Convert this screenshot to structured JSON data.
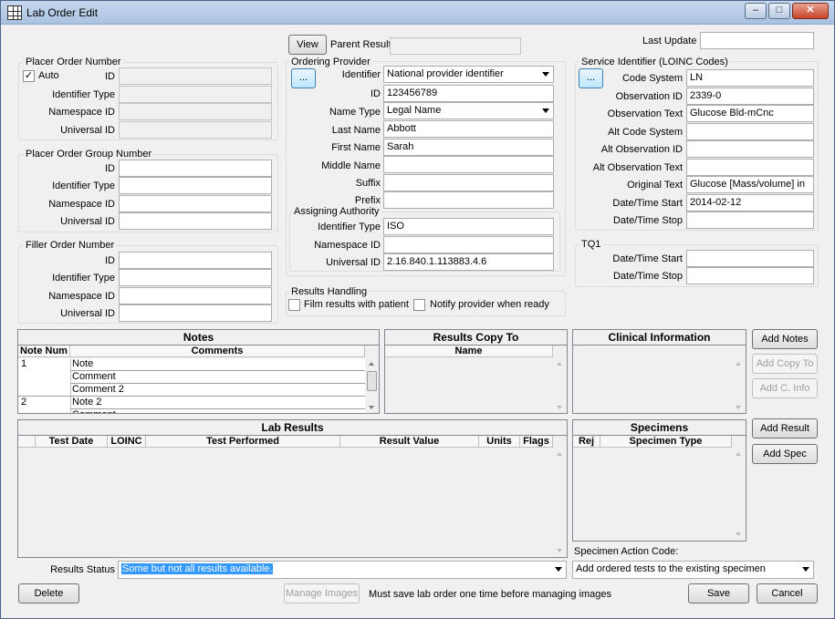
{
  "window": {
    "title": "Lab Order Edit",
    "minimize": "–",
    "maximize": "□",
    "close": "✕"
  },
  "top": {
    "view_label": "View",
    "parent_result_label": "Parent Result",
    "parent_result_value": "",
    "last_update_label": "Last Update",
    "last_update_value": ""
  },
  "placer_order": {
    "title": "Placer Order Number",
    "auto_label": "Auto",
    "auto_checked": "✓",
    "labels": {
      "id": "ID",
      "identifier_type": "Identifier Type",
      "namespace_id": "Namespace ID",
      "universal_id": "Universal ID"
    },
    "values": {
      "id": "",
      "identifier_type": "",
      "namespace_id": "",
      "universal_id": ""
    }
  },
  "placer_group": {
    "title": "Placer Order Group Number",
    "labels": {
      "id": "ID",
      "identifier_type": "Identifier Type",
      "namespace_id": "Namespace ID",
      "universal_id": "Universal ID"
    },
    "values": {
      "id": "",
      "identifier_type": "",
      "namespace_id": "",
      "universal_id": ""
    }
  },
  "filler_order": {
    "title": "Filler Order Number",
    "labels": {
      "id": "ID",
      "identifier_type": "Identifier Type",
      "namespace_id": "Namespace ID",
      "universal_id": "Universal ID"
    },
    "values": {
      "id": "",
      "identifier_type": "",
      "namespace_id": "",
      "universal_id": ""
    }
  },
  "ordering_provider": {
    "title": "Ordering Provider",
    "lookup_label": "...",
    "labels": {
      "identifier": "Identifier",
      "id": "ID",
      "name_type": "Name Type",
      "last_name": "Last Name",
      "first_name": "First Name",
      "middle_name": "Middle Name",
      "suffix": "Suffix",
      "prefix": "Prefix"
    },
    "values": {
      "identifier": "National provider identifier",
      "id": "123456789",
      "name_type": "Legal Name",
      "last_name": "Abbott",
      "first_name": "Sarah",
      "middle_name": "",
      "suffix": "",
      "prefix": ""
    },
    "assigning_authority": {
      "title": "Assigning Authority",
      "labels": {
        "identifier_type": "Identifier Type",
        "namespace_id": "Namespace ID",
        "universal_id": "Universal ID"
      },
      "values": {
        "identifier_type": "ISO",
        "namespace_id": "",
        "universal_id": "2.16.840.1.113883.4.6"
      }
    }
  },
  "results_handling": {
    "title": "Results Handling",
    "film_label": "Film results with patient",
    "notify_label": "Notify provider when ready"
  },
  "service_identifier": {
    "title": "Service Identifier (LOINC Codes)",
    "lookup_label": "...",
    "labels": {
      "code_system": "Code System",
      "observation_id": "Observation ID",
      "observation_text": "Observation Text",
      "alt_code_system": "Alt Code System",
      "alt_observation_id": "Alt Observation ID",
      "alt_observation_text": "Alt Observation Text",
      "original_text": "Original Text",
      "dt_start": "Date/Time Start",
      "dt_stop": "Date/Time Stop"
    },
    "values": {
      "code_system": "LN",
      "observation_id": "2339-0",
      "observation_text": "Glucose Bld-mCnc",
      "alt_code_system": "",
      "alt_observation_id": "",
      "alt_observation_text": "",
      "original_text": "Glucose [Mass/volume] in",
      "dt_start": "2014-02-12",
      "dt_stop": ""
    }
  },
  "tq1": {
    "title": "TQ1",
    "labels": {
      "dt_start": "Date/Time Start",
      "dt_stop": "Date/Time Stop"
    },
    "values": {
      "dt_start": "",
      "dt_stop": ""
    }
  },
  "notes": {
    "title": "Notes",
    "columns": [
      "Note Num",
      "Comments"
    ],
    "rows": [
      {
        "num": "1",
        "comment": "Note"
      },
      {
        "num": "",
        "comment": "Comment"
      },
      {
        "num": "",
        "comment": "Comment 2"
      },
      {
        "num": "2",
        "comment": "Note 2"
      },
      {
        "num": "",
        "comment": "Comment"
      }
    ]
  },
  "results_copy": {
    "title": "Results Copy To",
    "columns": [
      "Name"
    ]
  },
  "clinical_info": {
    "title": "Clinical Information"
  },
  "side_buttons": {
    "add_notes": "Add Notes",
    "add_copy_to": "Add Copy To",
    "add_c_info": "Add C. Info",
    "add_result": "Add Result",
    "add_spec": "Add Spec"
  },
  "lab_results": {
    "title": "Lab Results",
    "columns": [
      "Test Date",
      "LOINC",
      "Test Performed",
      "Result Value",
      "Units",
      "Flags"
    ]
  },
  "specimens": {
    "title": "Specimens",
    "columns": [
      "Rej",
      "Specimen Type"
    ],
    "action_label": "Specimen Action Code:",
    "action_value": "Add ordered tests to the existing specimen"
  },
  "results_status": {
    "label": "Results Status",
    "value": "Some but not all results available."
  },
  "bottom": {
    "delete": "Delete",
    "manage_images": "Manage Images",
    "note": "Must save lab order one time before managing images",
    "save": "Save",
    "cancel": "Cancel"
  }
}
